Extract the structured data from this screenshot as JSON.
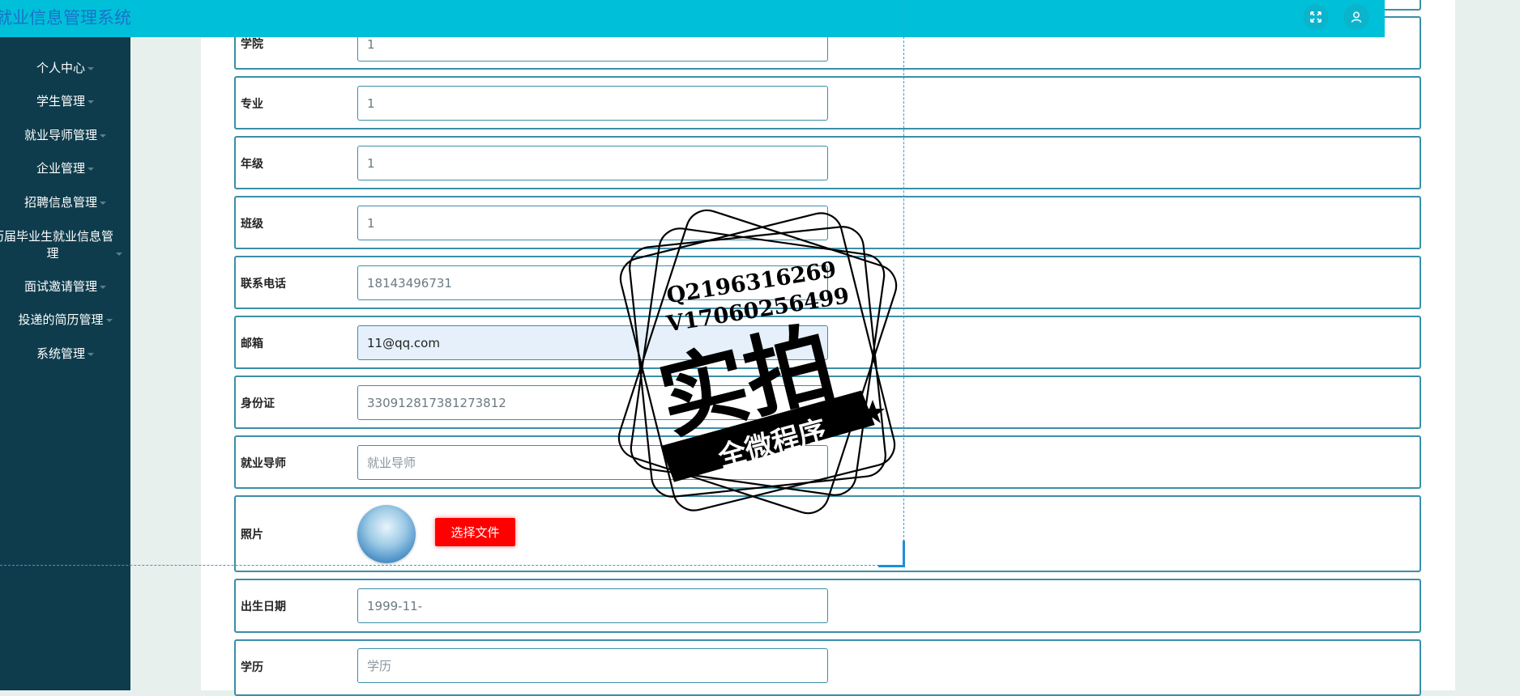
{
  "app": {
    "title": "就业信息管理系统"
  },
  "colors": {
    "sidebar": "#0e3c4c",
    "topbar": "#00c0d9",
    "accent": "#3a8fa8",
    "upload_button": "#ff0000"
  },
  "header": {
    "fullscreen_icon": "fullscreen-icon",
    "user_icon": "user-icon"
  },
  "sidebar": {
    "items": [
      {
        "label": "个人中心"
      },
      {
        "label": "学生管理"
      },
      {
        "label": "就业导师管理"
      },
      {
        "label": "企业管理"
      },
      {
        "label": "招聘信息管理"
      },
      {
        "label": "历届毕业生就业信息管理"
      },
      {
        "label": "面试邀请管理"
      },
      {
        "label": "投递的简历管理"
      },
      {
        "label": "系统管理"
      }
    ]
  },
  "form": {
    "fields": [
      {
        "label": "学院",
        "value": "1",
        "placeholder": ""
      },
      {
        "label": "专业",
        "value": "1",
        "placeholder": ""
      },
      {
        "label": "年级",
        "value": "1",
        "placeholder": ""
      },
      {
        "label": "班级",
        "value": "1",
        "placeholder": ""
      },
      {
        "label": "联系电话",
        "value": "18143496731",
        "placeholder": ""
      },
      {
        "label": "邮箱",
        "value": "11@qq.com",
        "placeholder": ""
      },
      {
        "label": "身份证",
        "value": "330912817381273812",
        "placeholder": ""
      },
      {
        "label": "就业导师",
        "value": "",
        "placeholder": "就业导师"
      },
      {
        "label": "出生日期",
        "value": "1999-11-",
        "placeholder": ""
      },
      {
        "label": "学历",
        "value": "",
        "placeholder": "学历"
      }
    ],
    "photo": {
      "label": "照片",
      "upload_label": "选择文件"
    }
  },
  "watermark": {
    "line1": "Q2196316269",
    "line2": "V17060256499",
    "main": "实拍",
    "banner": "全微程序"
  }
}
